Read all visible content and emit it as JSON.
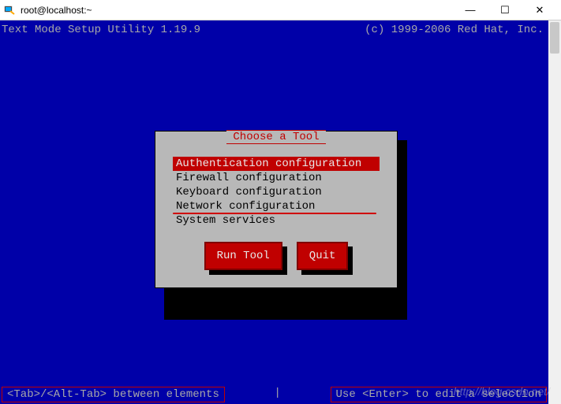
{
  "window": {
    "title": "root@localhost:~",
    "minimize": "—",
    "maximize": "☐",
    "close": "✕"
  },
  "header": {
    "left": "Text Mode Setup Utility 1.19.9",
    "right": "(c) 1999-2006 Red Hat, Inc."
  },
  "dialog": {
    "title": "Choose a Tool",
    "items": [
      "Authentication configuration",
      "Firewall configuration",
      "Keyboard configuration",
      "Network configuration",
      "System services"
    ],
    "selected_index": 0,
    "buttons": {
      "run": "Run Tool",
      "quit": "Quit"
    }
  },
  "footer": {
    "left": "<Tab>/<Alt-Tab> between elements",
    "sep": "|",
    "right": "Use <Enter> to edit a selection"
  },
  "watermark": "http://blog.csdn.net/"
}
